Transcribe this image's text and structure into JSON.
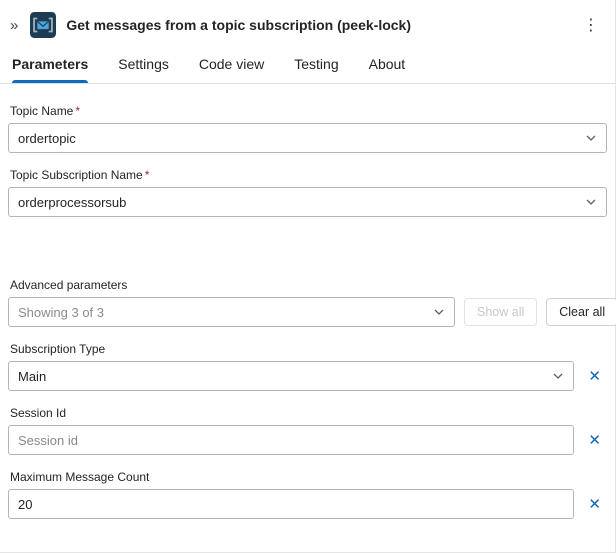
{
  "header": {
    "title": "Get messages from a topic subscription (peek-lock)",
    "collapse_icon": "»",
    "menu_icon": "⋮"
  },
  "tabs": [
    {
      "label": "Parameters",
      "active": true
    },
    {
      "label": "Settings",
      "active": false
    },
    {
      "label": "Code view",
      "active": false
    },
    {
      "label": "Testing",
      "active": false
    },
    {
      "label": "About",
      "active": false
    }
  ],
  "fields": {
    "topic_name": {
      "label": "Topic Name",
      "required": "*",
      "value": "ordertopic"
    },
    "topic_subscription_name": {
      "label": "Topic Subscription Name",
      "required": "*",
      "value": "orderprocessorsub"
    },
    "subscription_type": {
      "label": "Subscription Type",
      "value": "Main"
    },
    "session_id": {
      "label": "Session Id",
      "placeholder": "Session id"
    },
    "max_message_count": {
      "label": "Maximum Message Count",
      "value": "20"
    }
  },
  "advanced": {
    "label": "Advanced parameters",
    "dropdown_value": "Showing 3 of 3",
    "show_all_label": "Show all",
    "clear_all_label": "Clear all"
  },
  "icons": {
    "close": "✕"
  },
  "colors": {
    "accent": "#0f6cbd",
    "required": "#a4262c",
    "icon_bg": "#1d3b53",
    "icon_envelope": "#4ea3d8"
  }
}
